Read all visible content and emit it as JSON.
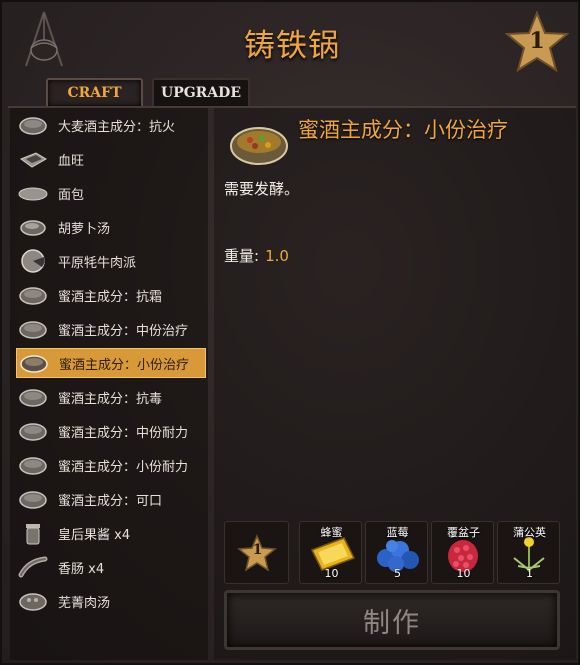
{
  "header": {
    "title": "铸铁锅",
    "station_level": "1"
  },
  "tabs": {
    "craft": "CRAFT",
    "upgrade": "UPGRADE"
  },
  "recipes": [
    {
      "label": "大麦酒主成分：抗火",
      "icon": "bowl-icon"
    },
    {
      "label": "血旺",
      "icon": "blood-pudding-icon"
    },
    {
      "label": "面包",
      "icon": "bread-icon"
    },
    {
      "label": "胡萝卜汤",
      "icon": "bowl-icon"
    },
    {
      "label": "平原牦牛肉派",
      "icon": "pie-icon"
    },
    {
      "label": "蜜酒主成分：抗霜",
      "icon": "bowl-icon"
    },
    {
      "label": "蜜酒主成分：中份治疗",
      "icon": "bowl-icon"
    },
    {
      "label": "蜜酒主成分：小份治疗",
      "icon": "bowl-icon",
      "selected": true
    },
    {
      "label": "蜜酒主成分：抗毒",
      "icon": "bowl-icon"
    },
    {
      "label": "蜜酒主成分：中份耐力",
      "icon": "bowl-icon"
    },
    {
      "label": "蜜酒主成分：小份耐力",
      "icon": "bowl-icon"
    },
    {
      "label": "蜜酒主成分：可口",
      "icon": "bowl-icon"
    },
    {
      "label": "皇后果酱 x4",
      "icon": "jam-jar-icon"
    },
    {
      "label": "香肠 x4",
      "icon": "sausage-icon"
    },
    {
      "label": "芜菁肉汤",
      "icon": "bowl-icon"
    }
  ],
  "detail": {
    "name": "蜜酒主成分：小份治疗",
    "description": "需要发酵。",
    "weight_label": "重量:",
    "weight_value": "1.0"
  },
  "requirements": {
    "level": "1",
    "ingredients": [
      {
        "name": "蜂蜜",
        "qty": "10",
        "icon": "honey-icon"
      },
      {
        "name": "蓝莓",
        "qty": "5",
        "icon": "blueberries-icon"
      },
      {
        "name": "覆盆子",
        "qty": "10",
        "icon": "raspberry-icon"
      },
      {
        "name": "蒲公英",
        "qty": "1",
        "icon": "dandelion-icon"
      }
    ]
  },
  "craft_button": "制作",
  "colors": {
    "accent": "#f0a640",
    "selected_row": "#d89a38",
    "background": "#2e2626"
  }
}
